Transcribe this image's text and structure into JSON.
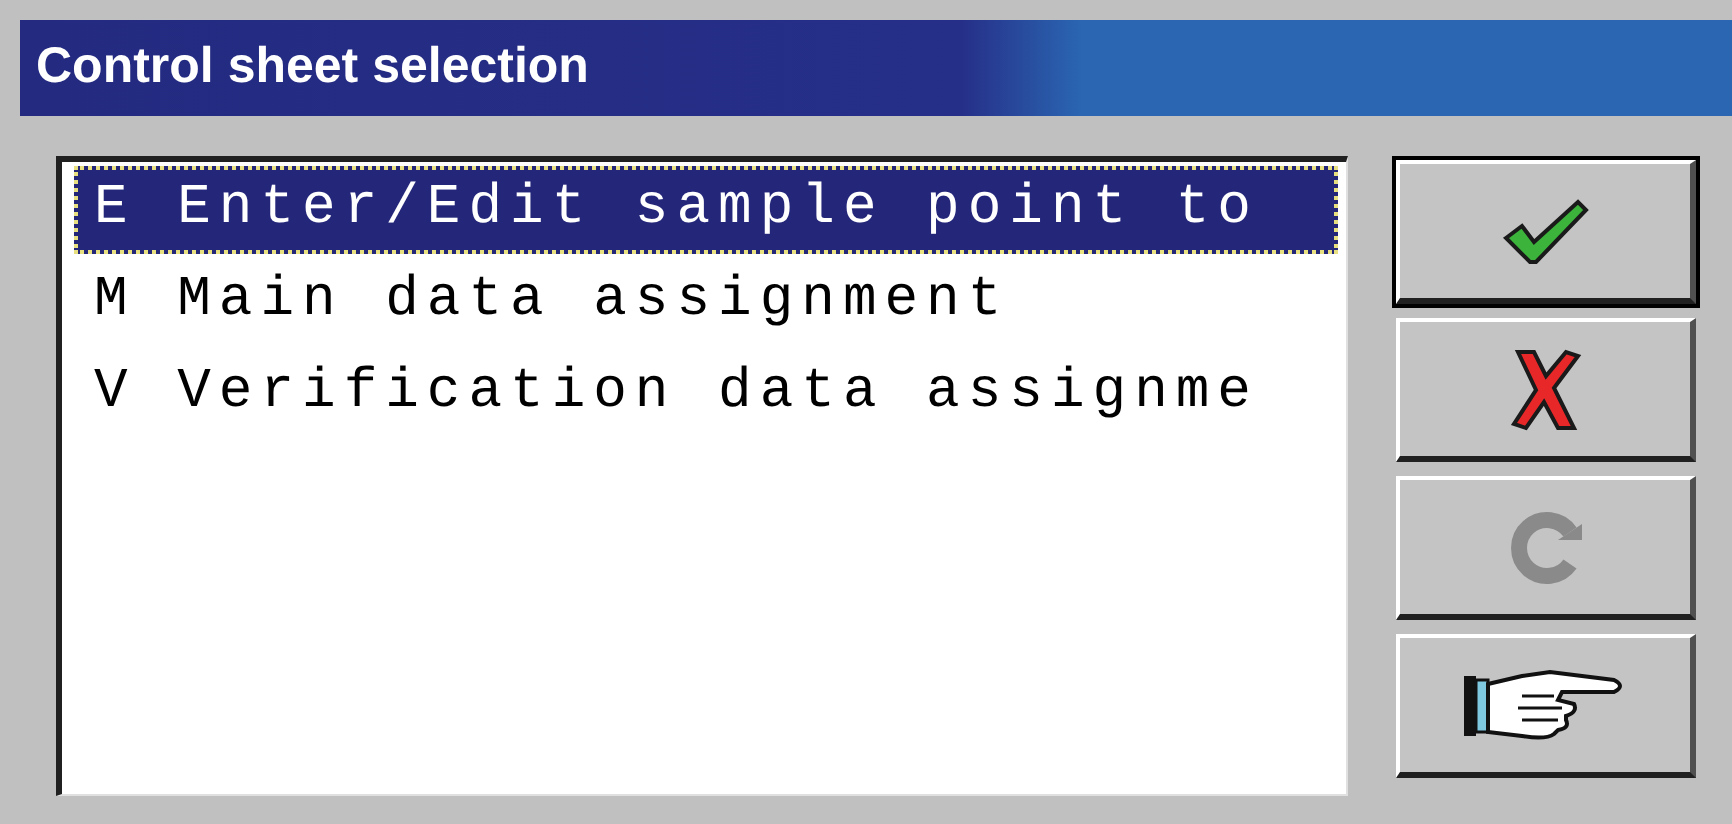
{
  "window": {
    "title": "Control sheet selection"
  },
  "list": {
    "items": [
      {
        "key": "E",
        "label": "Enter/Edit sample point to",
        "selected": true
      },
      {
        "key": "M",
        "label": "Main data assignment",
        "selected": false
      },
      {
        "key": "V",
        "label": "Verification data assignme",
        "selected": false
      }
    ]
  },
  "buttons": [
    {
      "kind": "ok",
      "disabled": false,
      "default": true
    },
    {
      "kind": "cancel",
      "disabled": false,
      "default": false
    },
    {
      "kind": "refresh",
      "disabled": true,
      "default": false
    },
    {
      "kind": "pointer",
      "disabled": false,
      "default": false
    }
  ]
}
